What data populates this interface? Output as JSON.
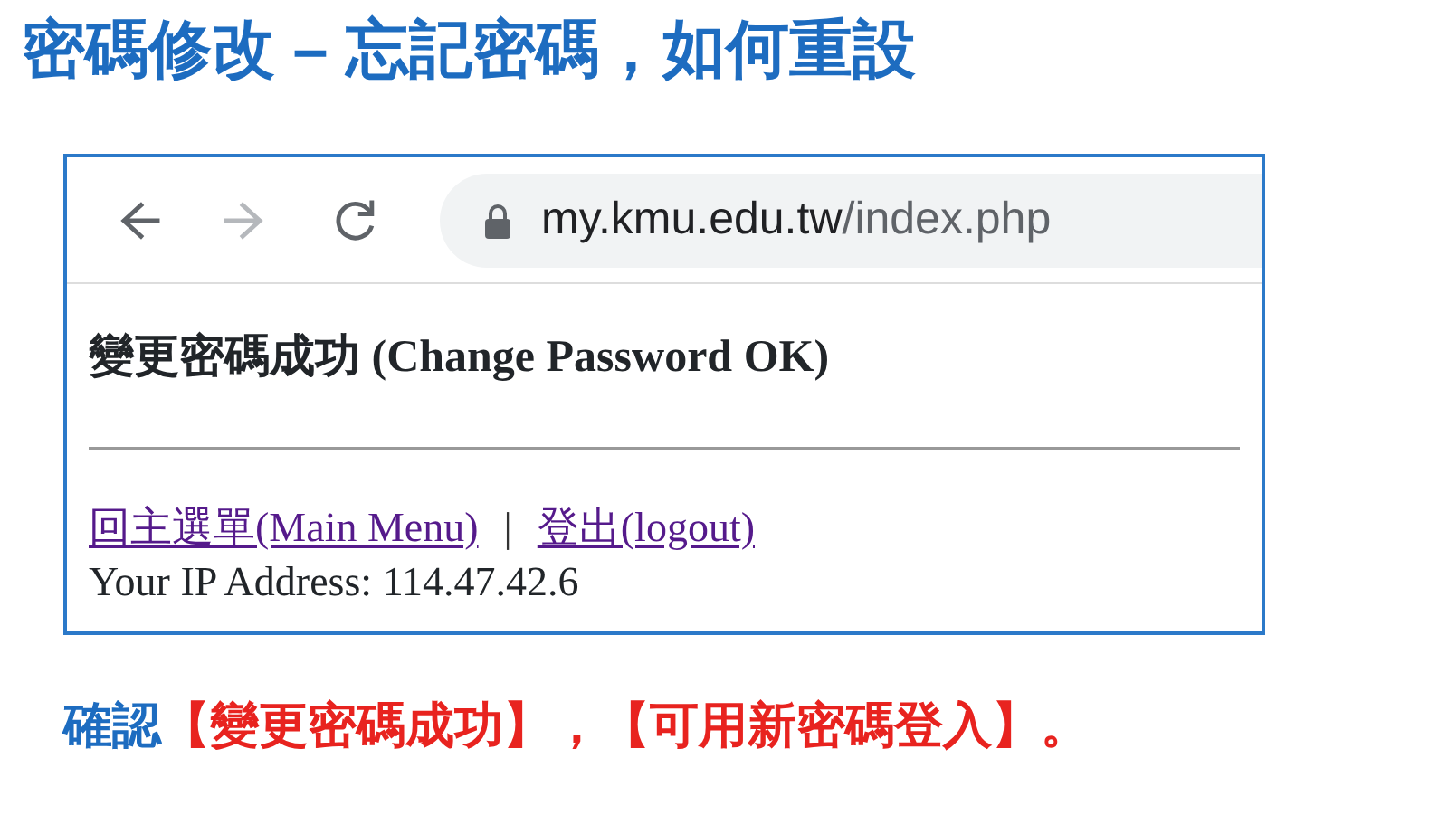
{
  "slide_title": "密碼修改 – 忘記密碼，如何重設",
  "browser": {
    "nav_buttons": [
      {
        "kind": "back",
        "disabled": false
      },
      {
        "kind": "forward",
        "disabled": true
      },
      {
        "kind": "reload",
        "disabled": false
      }
    ],
    "address": {
      "host": "my.kmu.edu.tw",
      "path": "/index.php"
    },
    "page": {
      "heading": "變更密碼成功 (Change Password OK)",
      "links": [
        {
          "label": "回主選單(Main Menu)"
        },
        {
          "label": "登出(logout)"
        }
      ],
      "separator": "|",
      "ip_line": "Your IP Address: 114.47.42.6"
    }
  },
  "caption": [
    {
      "text": "確認",
      "kind": "plain"
    },
    {
      "text": "【變更密碼成功】，【可用新密碼登入】。",
      "kind": "highlight"
    }
  ]
}
